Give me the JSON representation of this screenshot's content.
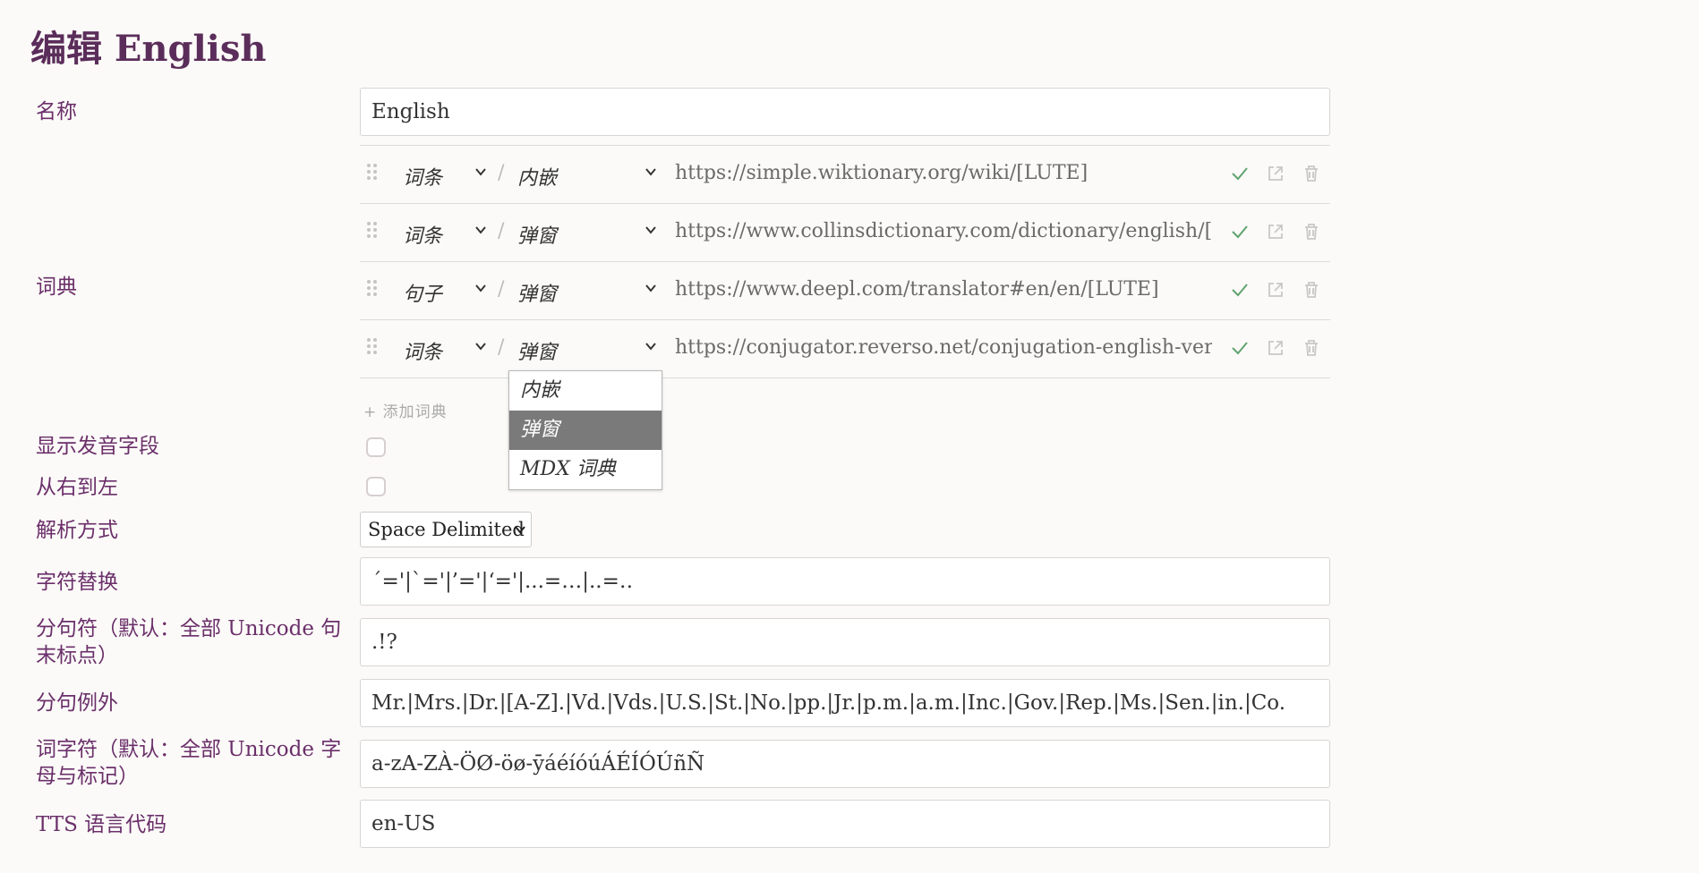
{
  "title": "编辑 English",
  "labels": {
    "name": "名称",
    "dictionaries": "词典",
    "show_pronunciation": "显示发音字段",
    "rtl": "从右到左",
    "parse_method": "解析方式",
    "char_substitutions": "字符替换",
    "sentence_terminators": "分句符（默认：全部 Unicode 句末标点）",
    "sentence_exceptions": "分句例外",
    "word_chars": "词字符（默认：全部 Unicode 字母与标记）",
    "tts_code": "TTS 语言代码"
  },
  "name_value": "English",
  "dictionaries": [
    {
      "use_for": "词条",
      "display": "内嵌",
      "url": "https://simple.wiktionary.org/wiki/[LUTE]"
    },
    {
      "use_for": "词条",
      "display": "弹窗",
      "url": "https://www.collinsdictionary.com/dictionary/english/[LUTE]"
    },
    {
      "use_for": "句子",
      "display": "弹窗",
      "url": "https://www.deepl.com/translator#en/en/[LUTE]"
    },
    {
      "use_for": "词条",
      "display": "弹窗",
      "url": "https://conjugator.reverso.net/conjugation-english-verb-[LUTE]"
    }
  ],
  "add_dictionary": "+ 添加词典",
  "dropdown_options": [
    "内嵌",
    "弹窗",
    "MDX 词典"
  ],
  "dropdown_selected": "弹窗",
  "parse_method_value": "Space Delimited",
  "char_substitutions_value": "´='|`='|’='|‘='|...=…|..=‥",
  "sentence_terminators_value": ".!?",
  "sentence_exceptions_value": "Mr.|Mrs.|Dr.|[A-Z].|Vd.|Vds.|U.S.|St.|No.|pp.|Jr.|p.m.|a.m.|Inc.|Gov.|Rep.|Ms.|Sen.|in.|Co.",
  "word_chars_value": "a-zA-ZÀ-ÖØ-öø-ȳáéíóúÁÉÍÓÚñÑ",
  "tts_code_value": "en-US",
  "colors": {
    "accent": "#5b2d5a",
    "ok": "#5fa36f"
  }
}
